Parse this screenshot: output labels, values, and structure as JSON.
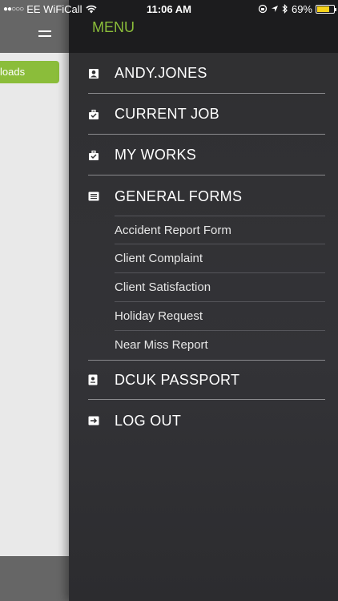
{
  "status_bar": {
    "carrier": "EE WiFiCall",
    "time": "11:06 AM",
    "battery": "69%",
    "battery_level": 0.69
  },
  "background": {
    "button_label": "loads"
  },
  "drawer": {
    "title": "MENU",
    "items": [
      {
        "label": "ANDY.JONES",
        "icon": "user-icon"
      },
      {
        "label": "CURRENT JOB",
        "icon": "briefcase-icon"
      },
      {
        "label": "MY WORKS",
        "icon": "briefcase-icon"
      },
      {
        "label": "GENERAL FORMS",
        "icon": "forms-icon"
      },
      {
        "label": "DCUK PASSPORT",
        "icon": "passport-icon"
      },
      {
        "label": "LOG OUT",
        "icon": "logout-icon"
      }
    ],
    "forms": [
      "Accident Report Form",
      "Client Complaint",
      "Client Satisfaction",
      "Holiday Request",
      "Near Miss Report"
    ]
  }
}
